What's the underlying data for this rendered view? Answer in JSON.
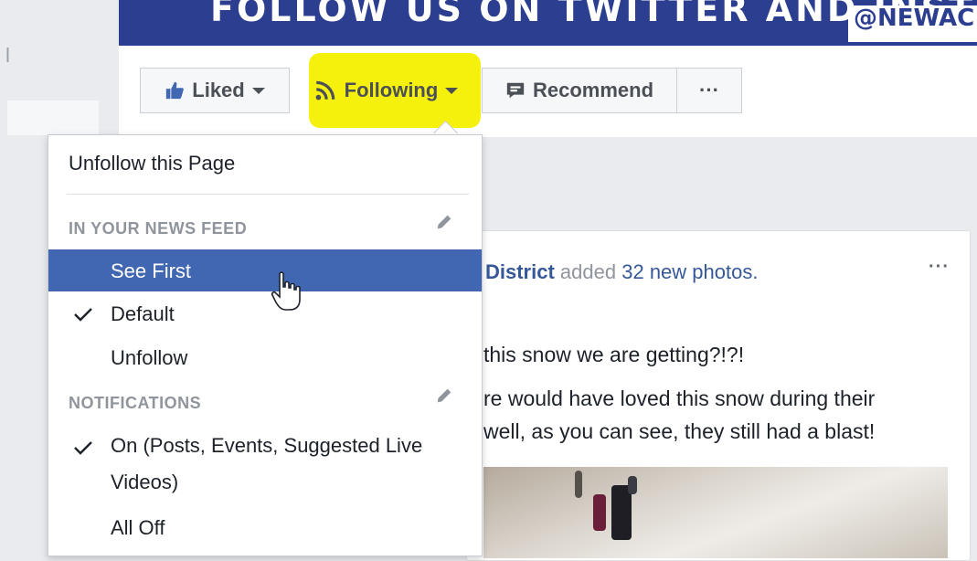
{
  "banner": {
    "text": "FOLLOW US ON TWITTER AND INSTAGRAM",
    "handle": "@NEWAC"
  },
  "left_column": {
    "fragment": "l"
  },
  "action_bar": {
    "liked": {
      "label": "Liked",
      "icon": "thumbs-up-icon"
    },
    "following": {
      "label": "Following",
      "icon": "rss-icon",
      "highlight_color": "#f4f000"
    },
    "recommend": {
      "label": "Recommend",
      "icon": "speech-bubble-icon"
    },
    "more": {
      "label": "···"
    }
  },
  "dropdown": {
    "unfollow_page": "Unfollow this Page",
    "news_feed_heading": "IN YOUR NEWS FEED",
    "news_feed_items": [
      {
        "label": "See First",
        "selected": true,
        "checked": false
      },
      {
        "label": "Default",
        "selected": false,
        "checked": true
      },
      {
        "label": "Unfollow",
        "selected": false,
        "checked": false
      }
    ],
    "notifications_heading": "NOTIFICATIONS",
    "notification_items": [
      {
        "label_line1": "On (Posts, Events, Suggested Live",
        "label_line2": "Videos)",
        "checked": true
      },
      {
        "label": "All Off",
        "checked": false
      }
    ],
    "selected_color": "#4267b2"
  },
  "post": {
    "author": "District",
    "action": "added",
    "photos": "32 new photos.",
    "more": "···",
    "line1": "this snow we are getting?!?!",
    "line2": "re would have loved this snow during their",
    "line3": "well, as you can see, they still had a blast!"
  },
  "colors": {
    "banner": "#2b3e8f",
    "link": "#365899",
    "page_bg": "#e9ebee"
  }
}
